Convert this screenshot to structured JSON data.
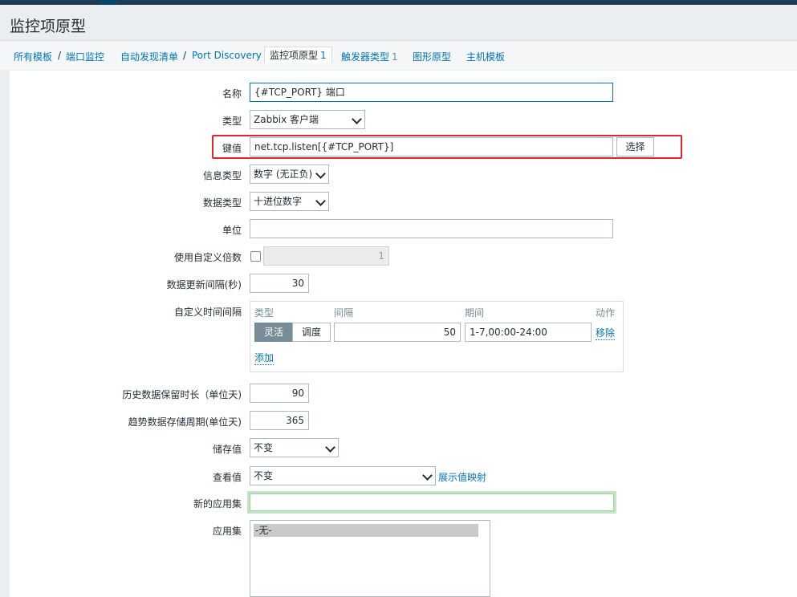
{
  "page_title": "监控项原型",
  "breadcrumb": {
    "all_templates": "所有模板",
    "separator": "/",
    "template": "端口监控",
    "discovery_list": "自动发现清单",
    "rule": "Port Discovery",
    "tabs": [
      {
        "label": "监控项原型",
        "count": "1"
      },
      {
        "label": "触发器类型",
        "count": "1"
      },
      {
        "label": "图形原型",
        "count": ""
      },
      {
        "label": "主机模板",
        "count": ""
      }
    ]
  },
  "form": {
    "name": {
      "label": "名称",
      "value": "{#TCP_PORT} 端口"
    },
    "type": {
      "label": "类型",
      "value": "Zabbix 客户端"
    },
    "key": {
      "label": "键值",
      "value": "net.tcp.listen[{#TCP_PORT}]",
      "select_button": "选择"
    },
    "info_type": {
      "label": "信息类型",
      "value": "数字 (无正负)"
    },
    "data_type": {
      "label": "数据类型",
      "value": "十进位数字"
    },
    "units": {
      "label": "单位",
      "value": ""
    },
    "multiplier": {
      "label": "使用自定义倍数",
      "value": "1"
    },
    "update_interval": {
      "label": "数据更新间隔(秒)",
      "value": "30"
    },
    "custom_intervals": {
      "label": "自定义时间间隔",
      "headers": {
        "type": "类型",
        "interval": "间隔",
        "period": "期间",
        "action": "动作"
      },
      "row": {
        "flexible": "灵活",
        "scheduling": "调度",
        "interval": "50",
        "period": "1-7,00:00-24:00",
        "remove": "移除"
      },
      "add": "添加"
    },
    "history": {
      "label": "历史数据保留时长（单位天)",
      "value": "90"
    },
    "trends": {
      "label": "趋势数据存储周期(单位天)",
      "value": "365"
    },
    "store_value": {
      "label": "储存值",
      "value": "不变"
    },
    "show_value": {
      "label": "查看值",
      "value": "不变",
      "link": "展示值映射"
    },
    "new_application": {
      "label": "新的应用集",
      "value": ""
    },
    "applications": {
      "label": "应用集",
      "options": [
        "-无-"
      ]
    }
  },
  "colors": {
    "accent": "#0275b8",
    "highlight": "#e5232a",
    "header": "#1f3a53"
  }
}
